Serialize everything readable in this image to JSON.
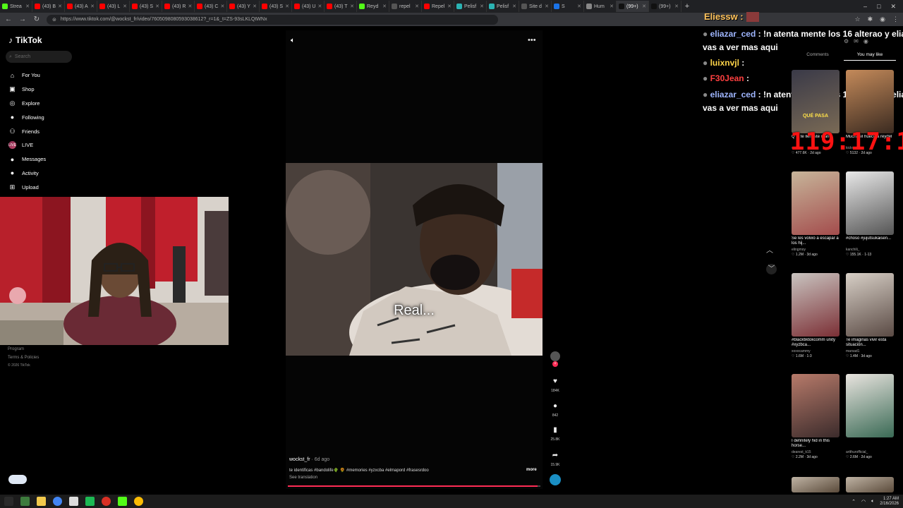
{
  "browser": {
    "tabs": [
      {
        "label": "Strea",
        "color": "#53fc18"
      },
      {
        "label": "(43) B",
        "color": "#ff0000"
      },
      {
        "label": "(43) A",
        "color": "#ff0000"
      },
      {
        "label": "(43) L",
        "color": "#ff0000"
      },
      {
        "label": "(43) S",
        "color": "#ff0000"
      },
      {
        "label": "(43) R",
        "color": "#ff0000"
      },
      {
        "label": "(43) C",
        "color": "#ff0000"
      },
      {
        "label": "(43) Y",
        "color": "#ff0000"
      },
      {
        "label": "(43) S",
        "color": "#ff0000"
      },
      {
        "label": "(43) U",
        "color": "#ff0000"
      },
      {
        "label": "(43) T",
        "color": "#ff0000"
      },
      {
        "label": "Reyd",
        "color": "#53fc18"
      },
      {
        "label": "repel",
        "color": "#555555"
      },
      {
        "label": "Repel",
        "color": "#ff0000"
      },
      {
        "label": "Pelisf",
        "color": "#2bb3b3"
      },
      {
        "label": "Pelisf",
        "color": "#2bb3b3"
      },
      {
        "label": "Site d",
        "color": "#555555"
      },
      {
        "label": "S",
        "color": "#1a73e8"
      },
      {
        "label": "Hum",
        "color": "#888888"
      },
      {
        "label": "(99+)",
        "color": "#111111"
      },
      {
        "label": "(99+)",
        "color": "#111111"
      }
    ],
    "new_tab": "+",
    "window_controls": [
      "–",
      "□",
      "✕"
    ],
    "url": "https://www.tiktok.com/@wockst_fr/video/7605098080593038612?_r=1&_t=ZS-93sLKLQtWNx"
  },
  "tiktok": {
    "logo": "TikTok",
    "search_placeholder": "Search",
    "menu": [
      {
        "label": "For You",
        "icon": "home-icon",
        "glyph": "⌂"
      },
      {
        "label": "Shop",
        "icon": "shop-icon",
        "glyph": "▣"
      },
      {
        "label": "Explore",
        "icon": "compass-icon",
        "glyph": "◎"
      },
      {
        "label": "Following",
        "icon": "following-icon",
        "glyph": "●"
      },
      {
        "label": "Friends",
        "icon": "friends-icon",
        "glyph": "⚇"
      },
      {
        "label": "LIVE",
        "icon": "live-icon",
        "glyph": "LIVE"
      },
      {
        "label": "Messages",
        "icon": "messages-icon",
        "glyph": "●"
      },
      {
        "label": "Activity",
        "icon": "activity-icon",
        "glyph": "●"
      },
      {
        "label": "Upload",
        "icon": "upload-icon",
        "glyph": "⊞"
      }
    ],
    "footer": {
      "program": "Program",
      "terms": "Terms & Policies",
      "copyright": "© 2026 TikTok"
    }
  },
  "video": {
    "subtitle": "Real...",
    "author": "wockst_fr",
    "date": "· 6d ago",
    "caption": "te identificas #bandolife🌵 🌻 #memories #yzxcba #elmapord #frasesrdoo",
    "more": "more",
    "see_translation": "See translation",
    "progress": 0.99,
    "actions": [
      {
        "icon": "heart-icon",
        "glyph": "♥",
        "count": "184K"
      },
      {
        "icon": "comment-icon",
        "glyph": "●",
        "count": "842"
      },
      {
        "icon": "bookmark-icon",
        "glyph": "▮",
        "count": "25.8K"
      },
      {
        "icon": "share-icon",
        "glyph": "➦",
        "count": "15.9K"
      }
    ]
  },
  "chat": {
    "top_user": "Eliessw :",
    "lines": [
      {
        "user": "eliazar_ced",
        "user_color": "#9fb6ff",
        "msg": " : !n atenta mente los 16 alterao y elia"
      },
      {
        "user": "luixnvjl",
        "user_color": "#ffd54a",
        "msg": " :"
      },
      {
        "user": "F30Jean",
        "user_color": "#ff4040",
        "msg": " :"
      },
      {
        "user": "eliazar_ced",
        "user_color": "#9fb6ff",
        "msg": " : !n atenta mente los 16 alterao y elia"
      }
    ],
    "continuation": "vas a ver mas aqui"
  },
  "right": {
    "tabs": [
      "Comments",
      "You may like"
    ],
    "timer": "119:17:14",
    "cards": [
      {
        "title": "Q el te llenaste mano",
        "author": "ocavm",
        "likes": "477.6K",
        "age": "2d ago",
        "c1": "#3a3a48",
        "c2": "#7a6a55",
        "overlay": "QUÉ PASA"
      },
      {
        "title": "Mucha el hueco a reydel",
        "author": "kickreyclips",
        "likes": "5132",
        "age": "2d ago",
        "c1": "#c48a5a",
        "c2": "#3a2a20",
        "overlay": ""
      },
      {
        "title": "Se les volvió a escapar a los hij...",
        "author": "elingmoy",
        "likes": "1.2M",
        "age": "3d ago",
        "c1": "#c7b59a",
        "c2": "#a34c4c",
        "overlay": ""
      },
      {
        "title": "#choso #jujutsukaisen...",
        "author": "kanchili_",
        "likes": "155.1K",
        "age": "1-13",
        "c1": "#e8e8e8",
        "c2": "#555555",
        "overlay": ""
      },
      {
        "title": "#blacktiktokcomm unity #xyzbca...",
        "author": "xoxocammy",
        "likes": "1.6M",
        "age": "1-3",
        "c1": "#c9c4c0",
        "c2": "#7b2f35",
        "overlay": ""
      },
      {
        "title": "Te imaginas vivir esta situación...",
        "author": "marsad1",
        "likes": "1.4M",
        "age": "3d ago",
        "c1": "#d7cfc6",
        "c2": "#5a4a44",
        "overlay": ""
      },
      {
        "title": "I definitely hid in this horse...",
        "author": "dearest_k15",
        "likes": "2.2M",
        "age": "3d ago",
        "c1": "#b77a6a",
        "c2": "#3b2b2b",
        "overlay": ""
      },
      {
        "title": "",
        "author": "artthurofficial_",
        "likes": "2.6M",
        "age": "2d ago",
        "c1": "#e9e4df",
        "c2": "#3a6a55",
        "overlay": ""
      }
    ]
  },
  "taskbar": {
    "apps": [
      "#2a2a2a",
      "#3d7b3d",
      "#f2c94c",
      "#4285f4",
      "#dddddd",
      "#1db954",
      "#d93025",
      "#53fc18",
      "#fbbc04"
    ],
    "time": "1:27 AM",
    "date": "2/16/2026"
  }
}
